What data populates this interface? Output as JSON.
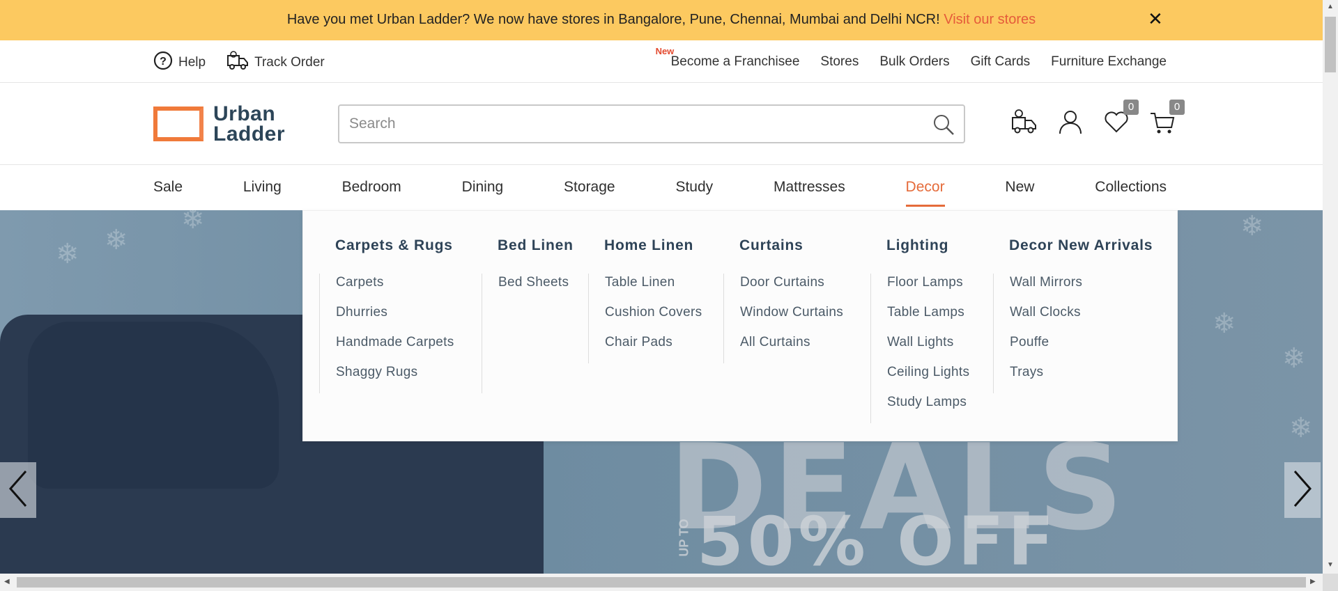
{
  "announcement": {
    "message": "Have you met Urban Ladder? We now have stores in Bangalore, Pune, Chennai, Mumbai and Delhi NCR!",
    "link": "Visit our stores",
    "close": "✕"
  },
  "utility": {
    "help": "Help",
    "track_order": "Track Order",
    "new_tag": "New",
    "links": [
      "Become a Franchisee",
      "Stores",
      "Bulk Orders",
      "Gift Cards",
      "Furniture Exchange"
    ]
  },
  "header": {
    "logo_line1": "Urban",
    "logo_line2": "Ladder",
    "search_placeholder": "Search",
    "wishlist_count": "0",
    "cart_count": "0"
  },
  "nav": {
    "items": [
      "Sale",
      "Living",
      "Bedroom",
      "Dining",
      "Storage",
      "Study",
      "Mattresses",
      "Decor",
      "New",
      "Collections"
    ],
    "active": "Decor"
  },
  "mega_menu": {
    "columns": [
      {
        "heading": "Carpets & Rugs",
        "links": [
          "Carpets",
          "Dhurries",
          "Handmade Carpets",
          "Shaggy Rugs"
        ]
      },
      {
        "heading": "Bed Linen",
        "links": [
          "Bed Sheets"
        ]
      },
      {
        "heading": "Home Linen",
        "links": [
          "Table Linen",
          "Cushion Covers",
          "Chair Pads"
        ]
      },
      {
        "heading": "Curtains",
        "links": [
          "Door Curtains",
          "Window Curtains",
          "All Curtains"
        ]
      },
      {
        "heading": "Lighting",
        "links": [
          "Floor Lamps",
          "Table Lamps",
          "Wall Lights",
          "Ceiling Lights",
          "Study Lamps"
        ]
      },
      {
        "heading": "Decor New Arrivals",
        "links": [
          "Wall Mirrors",
          "Wall Clocks",
          "Pouffe",
          "Trays"
        ]
      }
    ]
  },
  "hero": {
    "word": "DEALS",
    "upto": "UP TO",
    "offer": "50% OFF"
  },
  "colors": {
    "accent": "#e56b3a",
    "announcement_bg": "#fcc960",
    "brand_text": "#2c4558"
  }
}
